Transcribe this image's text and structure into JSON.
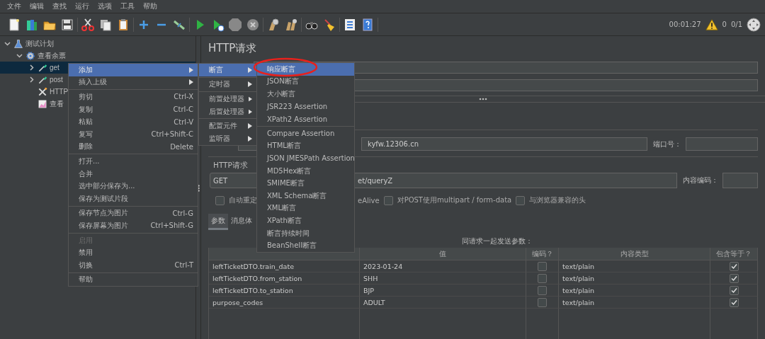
{
  "menu_bar": [
    "文件",
    "编辑",
    "查找",
    "运行",
    "选项",
    "工具",
    "帮助"
  ],
  "status": {
    "elapsed": "00:01:27",
    "warnings": "0",
    "threads": "0/1"
  },
  "tree": [
    {
      "label": "测试计划",
      "kind": "plan",
      "expanded": true,
      "selected": false,
      "children": [
        {
          "label": "查看余票",
          "kind": "thread_group",
          "expanded": true,
          "selected": false,
          "children": [
            {
              "label": "get",
              "kind": "sampler",
              "expanded": false,
              "selected": true
            },
            {
              "label": "post",
              "kind": "sampler",
              "expanded": false,
              "selected": false
            },
            {
              "label": "HTTP",
              "kind": "config",
              "selected": false
            },
            {
              "label": "查看",
              "kind": "listener",
              "selected": false
            }
          ]
        }
      ]
    }
  ],
  "panel": {
    "title": "HTTP请求",
    "server_value": "kyfw.12306.cn",
    "port_label": "端口号：",
    "request_group": "HTTP请求",
    "method": "GET",
    "path_value": "et/queryZ",
    "encoding_label": "内容编码：",
    "options": [
      {
        "label": "自动重定",
        "checked": false
      },
      {
        "label": "eAlive",
        "kind": "fragment"
      },
      {
        "label": "对POST使用multipart / form-data",
        "checked": false
      },
      {
        "label": "与浏览器兼容的头",
        "checked": false
      }
    ],
    "tabs": [
      {
        "label": "参数",
        "selected": true
      },
      {
        "label": "消息体",
        "selected": false
      }
    ],
    "table_caption": "同请求一起发送参数：",
    "columns": [
      "值",
      "编码？",
      "内容类型",
      "包含等于？"
    ],
    "rows": [
      {
        "name": "leftTicketDTO.train_date",
        "value": "2023-01-24",
        "encode": false,
        "content_type": "text/plain",
        "include_equals": true
      },
      {
        "name": "leftTicketDTO.from_station",
        "value": "SHH",
        "encode": false,
        "content_type": "text/plain",
        "include_equals": true
      },
      {
        "name": "leftTicketDTO.to_station",
        "value": "BJP",
        "encode": false,
        "content_type": "text/plain",
        "include_equals": true
      },
      {
        "name": "purpose_codes",
        "value": "ADULT",
        "encode": false,
        "content_type": "text/plain",
        "include_equals": true
      }
    ]
  },
  "context_menu": [
    {
      "kind": "item",
      "label": "添加",
      "submenu": true,
      "selected": true,
      "disabled": false
    },
    {
      "kind": "item",
      "label": "插入上级",
      "submenu": true,
      "selected": false,
      "disabled": false
    },
    {
      "kind": "separator"
    },
    {
      "kind": "item",
      "label": "剪切",
      "shortcut": "Ctrl-X",
      "submenu": false,
      "selected": false,
      "disabled": false
    },
    {
      "kind": "item",
      "label": "复制",
      "shortcut": "Ctrl-C",
      "submenu": false,
      "selected": false,
      "disabled": false
    },
    {
      "kind": "item",
      "label": "粘贴",
      "shortcut": "Ctrl-V",
      "submenu": false,
      "selected": false,
      "disabled": false
    },
    {
      "kind": "item",
      "label": "复写",
      "shortcut": "Ctrl+Shift-C",
      "submenu": false,
      "selected": false,
      "disabled": false
    },
    {
      "kind": "item",
      "label": "删除",
      "shortcut": "Delete",
      "submenu": false,
      "selected": false,
      "disabled": false
    },
    {
      "kind": "separator"
    },
    {
      "kind": "item",
      "label": "打开...",
      "submenu": false,
      "selected": false,
      "disabled": false
    },
    {
      "kind": "item",
      "label": "合并",
      "submenu": false,
      "selected": false,
      "disabled": false
    },
    {
      "kind": "item",
      "label": "选中部分保存为...",
      "submenu": false,
      "selected": false,
      "disabled": false
    },
    {
      "kind": "item",
      "label": "保存为测试片段",
      "submenu": false,
      "selected": false,
      "disabled": false
    },
    {
      "kind": "separator"
    },
    {
      "kind": "item",
      "label": "保存节点为图片",
      "shortcut": "Ctrl-G",
      "submenu": false,
      "selected": false,
      "disabled": false
    },
    {
      "kind": "item",
      "label": "保存屏幕为图片",
      "shortcut": "Ctrl+Shift-G",
      "submenu": false,
      "selected": false,
      "disabled": false
    },
    {
      "kind": "separator"
    },
    {
      "kind": "item",
      "label": "启用",
      "submenu": false,
      "selected": false,
      "disabled": true
    },
    {
      "kind": "item",
      "label": "禁用",
      "submenu": false,
      "selected": false,
      "disabled": false
    },
    {
      "kind": "item",
      "label": "切换",
      "shortcut": "Ctrl-T",
      "submenu": false,
      "selected": false,
      "disabled": false
    },
    {
      "kind": "separator"
    },
    {
      "kind": "item",
      "label": "帮助",
      "submenu": false,
      "selected": false,
      "disabled": false
    }
  ],
  "add_submenu": [
    {
      "kind": "item",
      "label": "断言",
      "submenu": true,
      "selected": true
    },
    {
      "kind": "separator"
    },
    {
      "kind": "item",
      "label": "定时器",
      "submenu": true,
      "selected": false
    },
    {
      "kind": "separator"
    },
    {
      "kind": "item",
      "label": "前置处理器",
      "submenu": true,
      "selected": false
    },
    {
      "kind": "item",
      "label": "后置处理器",
      "submenu": true,
      "selected": false
    },
    {
      "kind": "separator"
    },
    {
      "kind": "item",
      "label": "配置元件",
      "submenu": true,
      "selected": false
    },
    {
      "kind": "item",
      "label": "监听器",
      "submenu": true,
      "selected": false
    }
  ],
  "assertion_submenu": [
    {
      "kind": "item",
      "label": "响应断言",
      "selected": true,
      "circled": true
    },
    {
      "kind": "item",
      "label": "JSON断言",
      "selected": false,
      "circled": false
    },
    {
      "kind": "item",
      "label": "大小断言",
      "selected": false,
      "circled": false
    },
    {
      "kind": "item",
      "label": "JSR223 Assertion",
      "selected": false,
      "circled": false
    },
    {
      "kind": "item",
      "label": "XPath2 Assertion",
      "selected": false,
      "circled": false
    },
    {
      "kind": "separator"
    },
    {
      "kind": "item",
      "label": "Compare Assertion",
      "selected": false,
      "circled": false
    },
    {
      "kind": "item",
      "label": "HTML断言",
      "selected": false,
      "circled": false
    },
    {
      "kind": "item",
      "label": "JSON JMESPath Assertion",
      "selected": false,
      "circled": false
    },
    {
      "kind": "item",
      "label": "MD5Hex断言",
      "selected": false,
      "circled": false
    },
    {
      "kind": "item",
      "label": "SMIME断言",
      "selected": false,
      "circled": false
    },
    {
      "kind": "item",
      "label": "XML Schema断言",
      "selected": false,
      "circled": false
    },
    {
      "kind": "item",
      "label": "XML断言",
      "selected": false,
      "circled": false
    },
    {
      "kind": "item",
      "label": "XPath断言",
      "selected": false,
      "circled": false
    },
    {
      "kind": "item",
      "label": "断言持续时间",
      "selected": false,
      "circled": false
    },
    {
      "kind": "item",
      "label": "BeanShell断言",
      "selected": false,
      "circled": false
    }
  ]
}
